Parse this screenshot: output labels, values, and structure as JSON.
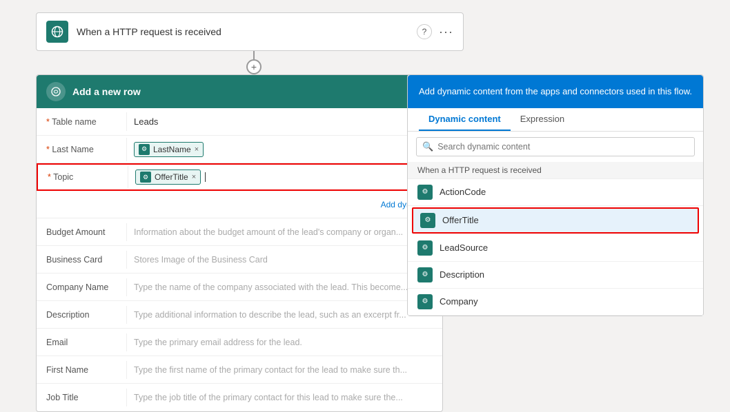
{
  "http_card": {
    "title": "When a HTTP request is received",
    "icon": "🌐",
    "help_icon": "?",
    "more_icon": "..."
  },
  "connector": {
    "plus_label": "+"
  },
  "main_card": {
    "header_title": "Add a new row",
    "icon": "↻",
    "fields": [
      {
        "label": "Table name",
        "required": true,
        "value": "Leads",
        "type": "text"
      },
      {
        "label": "Last Name",
        "required": true,
        "value": "LastName",
        "type": "chip"
      },
      {
        "label": "Topic",
        "required": true,
        "value": "OfferTitle",
        "type": "chip-input"
      },
      {
        "label": "",
        "required": false,
        "value": "Add dynamic...",
        "type": "link"
      },
      {
        "label": "Budget Amount",
        "required": false,
        "value": "Information about the budget amount of the lead's company or organ...",
        "type": "placeholder"
      },
      {
        "label": "Business Card",
        "required": false,
        "value": "Stores Image of the Business Card",
        "type": "placeholder"
      },
      {
        "label": "Company Name",
        "required": false,
        "value": "Type the name of the company associated with the lead. This become...",
        "type": "placeholder"
      },
      {
        "label": "Description",
        "required": false,
        "value": "Type additional information to describe the lead, such as an excerpt fr...",
        "type": "placeholder"
      },
      {
        "label": "Email",
        "required": false,
        "value": "Type the primary email address for the lead.",
        "type": "placeholder"
      },
      {
        "label": "First Name",
        "required": false,
        "value": "Type the first name of the primary contact for the lead to make sure th...",
        "type": "placeholder"
      },
      {
        "label": "Job Title",
        "required": false,
        "value": "Type the job title of the primary contact for this lead to make sure the...",
        "type": "placeholder"
      }
    ]
  },
  "right_panel": {
    "header_text": "Add dynamic content from the apps and connectors used in this flow.",
    "tab_dynamic": "Dynamic content",
    "tab_expression": "Expression",
    "search_placeholder": "Search dynamic content",
    "section_label": "When a HTTP request is received",
    "items": [
      {
        "label": "ActionCode",
        "icon": "⚙"
      },
      {
        "label": "OfferTitle",
        "icon": "⚙",
        "highlighted": true
      },
      {
        "label": "LeadSource",
        "icon": "⚙"
      },
      {
        "label": "Description",
        "icon": "⚙"
      },
      {
        "label": "Company",
        "icon": "⚙"
      }
    ]
  }
}
